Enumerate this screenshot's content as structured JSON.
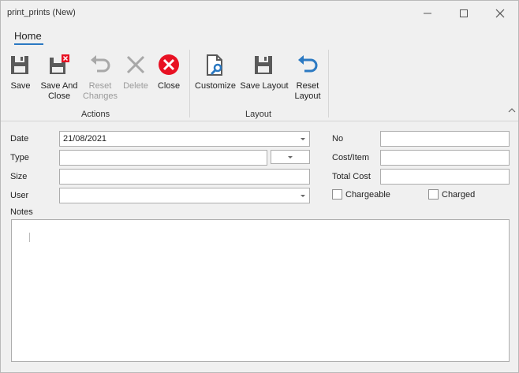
{
  "window": {
    "title": "print_prints (New)"
  },
  "ribbon": {
    "tab": "Home",
    "groups": {
      "actions": "Actions",
      "layout": "Layout"
    },
    "buttons": {
      "save": "Save",
      "save_and_close_1": "Save And",
      "save_and_close_2": "Close",
      "reset_changes_1": "Reset",
      "reset_changes_2": "Changes",
      "delete": "Delete",
      "close": "Close",
      "customize": "Customize",
      "save_layout": "Save Layout",
      "reset_layout_1": "Reset",
      "reset_layout_2": "Layout"
    }
  },
  "form": {
    "date": {
      "label": "Date",
      "value": "21/08/2021"
    },
    "type": {
      "label": "Type",
      "value": ""
    },
    "size": {
      "label": "Size",
      "value": ""
    },
    "user": {
      "label": "User",
      "value": ""
    },
    "notes": {
      "label": "Notes",
      "value": ""
    },
    "no": {
      "label": "No",
      "value": ""
    },
    "cost_item": {
      "label": "Cost/Item",
      "value": ""
    },
    "total_cost": {
      "label": "Total Cost",
      "value": ""
    },
    "chargeable": {
      "label": "Chargeable",
      "checked": false
    },
    "charged": {
      "label": "Charged",
      "checked": false
    }
  },
  "colors": {
    "accent": "#2b79c2",
    "close_red": "#e81123",
    "icon_gray": "#5f5f5f"
  }
}
